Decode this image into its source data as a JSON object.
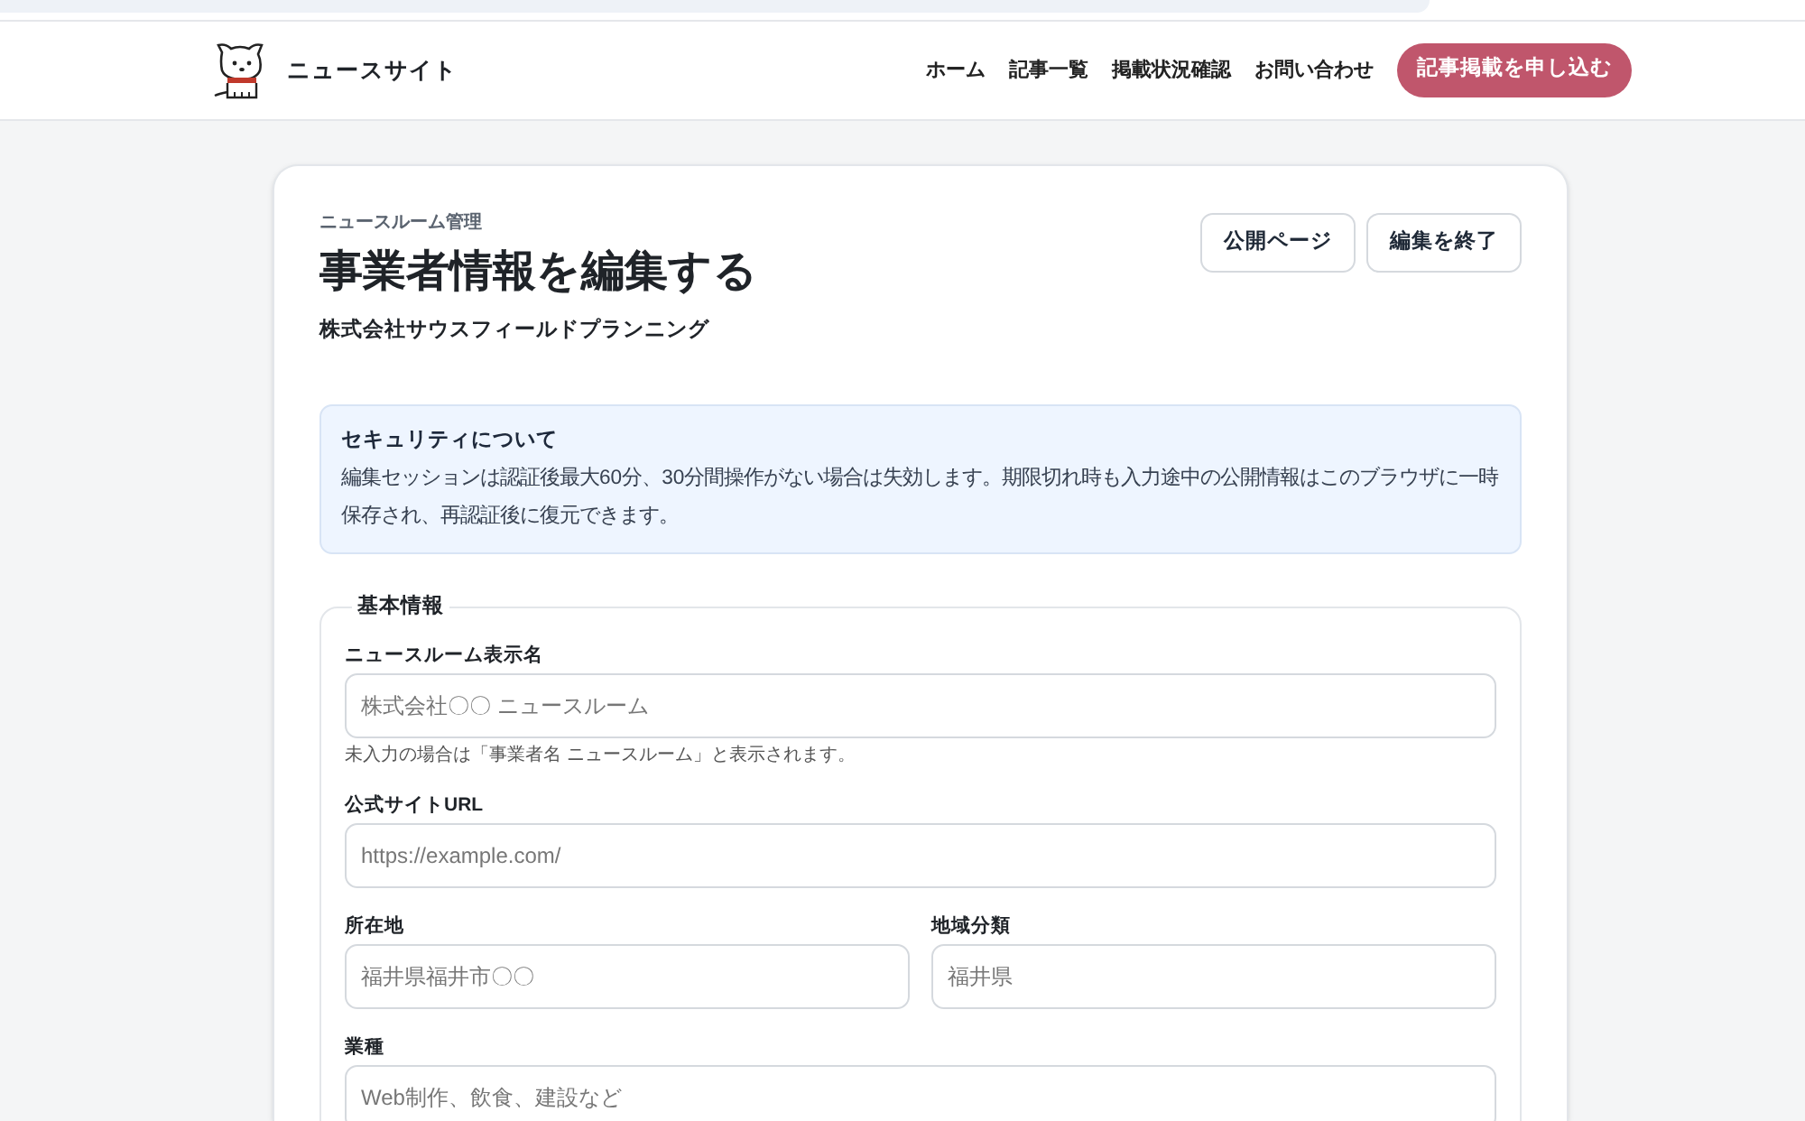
{
  "header": {
    "site_name": "ニュースサイト",
    "nav": [
      {
        "label": "ホーム"
      },
      {
        "label": "記事一覧"
      },
      {
        "label": "掲載状況確認"
      },
      {
        "label": "お問い合わせ"
      }
    ],
    "cta": "記事掲載を申し込む"
  },
  "page": {
    "eyebrow": "ニュースルーム管理",
    "title": "事業者情報を編集する",
    "company": "株式会社サウスフィールドプランニング",
    "actions": [
      {
        "label": "公開ページ"
      },
      {
        "label": "編集を終了"
      }
    ]
  },
  "notice": {
    "title": "セキュリティについて",
    "body": "編集セッションは認証後最大60分、30分間操作がない場合は失効します。期限切れ時も入力途中の公開情報はこのブラウザに一時保存され、再認証後に復元できます。"
  },
  "fieldset": {
    "legend": "基本情報",
    "rows": [
      [
        {
          "label": "ニュースルーム表示名",
          "placeholder": "株式会社〇〇 ニュースルーム",
          "hint": "未入力の場合は「事業者名 ニュースルーム」と表示されます。"
        }
      ],
      [
        {
          "label": "公式サイトURL",
          "placeholder": "https://example.com/"
        }
      ],
      [
        {
          "label": "所在地",
          "placeholder": "福井県福井市〇〇"
        },
        {
          "label": "地域分類",
          "placeholder": "福井県"
        }
      ],
      [
        {
          "label": "業種",
          "placeholder": "Web制作、飲食、建設など"
        }
      ]
    ]
  }
}
